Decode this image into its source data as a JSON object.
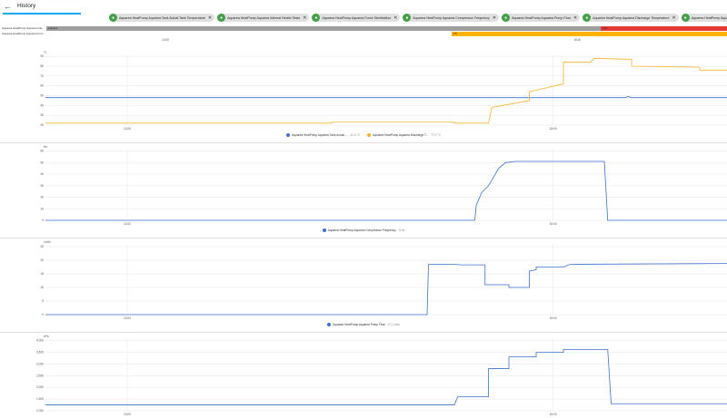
{
  "header": {
    "title": "History",
    "back_icon": "arrow-left-icon"
  },
  "chips": [
    {
      "label": "Aquarea HeatPump Aquarea Tank Actual Tank Temperature",
      "icon": "thermometer-icon"
    },
    {
      "label": "Aquarea HeatPump Aquarea Internal Heater State",
      "icon": "thermometer-icon"
    },
    {
      "label": "Aquarea HeatPump Aquarea Force Sterilization",
      "icon": "water-icon"
    },
    {
      "label": "Aquarea HeatPump Aquarea Compressor Frequency",
      "icon": "pulse-icon"
    },
    {
      "label": "Aquarea HeatPump Aquarea Pump Flow",
      "icon": "pump-icon"
    },
    {
      "label": "Aquarea HeatPump Aquarea Discharge Temperature",
      "icon": "thermometer-icon"
    },
    {
      "label": "Aquarea HeatPump Aquarea High pressure",
      "icon": "gauge-icon"
    }
  ],
  "timeline": {
    "rows": [
      {
        "label": "Aquarea HeatPump Aquarea Inte...",
        "segments": [
          {
            "label": "Inactive",
            "from": 0,
            "to": 0.815,
            "color": "#9e9e9e"
          },
          {
            "label": "Hot",
            "from": 0.815,
            "to": 1,
            "color": "#e53935"
          }
        ]
      },
      {
        "label": "Aquarea HeatPump Aquarea Forc...",
        "segments": [
          {
            "label": "Off",
            "from": 0.595,
            "to": 1,
            "color": "#ffb300"
          }
        ]
      }
    ],
    "ticks": [
      {
        "label": "13:00",
        "pos": 0.175
      },
      {
        "label": "15:00",
        "pos": 0.78
      }
    ]
  },
  "charts": [
    {
      "unit": "°C",
      "y_ticks": [
        20,
        30,
        40,
        50,
        60,
        70,
        80,
        90
      ],
      "ylim": [
        20,
        92
      ],
      "x_ticks": [
        {
          "label": "13:00",
          "pos": 0.12
        },
        {
          "label": "15:00",
          "pos": 0.745
        }
      ],
      "series": [
        {
          "name": "Aquarea HeatPump Aquarea Tank Actual ...",
          "value_label": "61.0 °C",
          "color": "#3f6fd1",
          "points": [
            [
              0,
              48
            ],
            [
              0.85,
              48
            ],
            [
              0.855,
              49
            ],
            [
              0.86,
              48
            ],
            [
              1,
              48
            ]
          ]
        },
        {
          "name": "Aquarea HeatPump Aquarea Discharge T...",
          "value_label": "77.0 °C",
          "color": "#f4b42a",
          "points": [
            [
              0,
              22
            ],
            [
              0.42,
              22
            ],
            [
              0.42,
              23
            ],
            [
              0.6,
              23
            ],
            [
              0.6,
              22
            ],
            [
              0.65,
              22
            ],
            [
              0.655,
              38
            ],
            [
              0.71,
              45
            ],
            [
              0.71,
              54
            ],
            [
              0.76,
              62
            ],
            [
              0.76,
              84
            ],
            [
              0.8,
              84
            ],
            [
              0.805,
              88
            ],
            [
              0.86,
              87
            ],
            [
              0.86,
              80
            ],
            [
              0.96,
              79
            ],
            [
              0.96,
              76
            ],
            [
              1,
              76
            ]
          ]
        }
      ]
    },
    {
      "unit": "Hz",
      "y_ticks": [
        0,
        10,
        20,
        30,
        40,
        50,
        60
      ],
      "ylim": [
        0,
        62
      ],
      "x_ticks": [
        {
          "label": "13:00",
          "pos": 0.12
        },
        {
          "label": "15:00",
          "pos": 0.745
        }
      ],
      "series": [
        {
          "name": "Aquarea HeatPump Aquarea Compressor Frequency",
          "value_label": "0 Hz",
          "color": "#3f6fd1",
          "points": [
            [
              0,
              0
            ],
            [
              0.63,
              0
            ],
            [
              0.632,
              13
            ],
            [
              0.64,
              24
            ],
            [
              0.65,
              30
            ],
            [
              0.66,
              40
            ],
            [
              0.665,
              45
            ],
            [
              0.675,
              50
            ],
            [
              0.69,
              51
            ],
            [
              0.82,
              51
            ],
            [
              0.825,
              0
            ],
            [
              1,
              0
            ]
          ]
        }
      ]
    },
    {
      "unit": "L/min",
      "y_ticks": [
        0,
        5,
        10,
        15,
        20,
        25
      ],
      "ylim": [
        0,
        26
      ],
      "x_ticks": [
        {
          "label": "13:00",
          "pos": 0.12
        },
        {
          "label": "15:00",
          "pos": 0.745
        }
      ],
      "series": [
        {
          "name": "Aquarea HeatPump Aquarea Pump Flow",
          "value_label": "0.7 L/min",
          "color": "#3f6fd1",
          "points": [
            [
              0,
              0
            ],
            [
              0.56,
              0
            ],
            [
              0.562,
              18.5
            ],
            [
              0.6,
              18.5
            ],
            [
              0.61,
              18.3
            ],
            [
              0.645,
              18.3
            ],
            [
              0.645,
              11
            ],
            [
              0.68,
              11
            ],
            [
              0.68,
              10
            ],
            [
              0.71,
              10
            ],
            [
              0.71,
              16
            ],
            [
              0.72,
              16.5
            ],
            [
              0.72,
              17.5
            ],
            [
              0.76,
              17.5
            ],
            [
              0.77,
              18.5
            ],
            [
              1,
              18.8
            ]
          ]
        }
      ]
    },
    {
      "unit": "kPa",
      "y_ticks": [
        1000,
        1500,
        2000,
        2500,
        3000,
        3500,
        4000
      ],
      "ylim": [
        1000,
        4100
      ],
      "x_ticks": [
        {
          "label": "13:00",
          "pos": 0.12
        },
        {
          "label": "15:00",
          "pos": 0.745
        }
      ],
      "series": [
        {
          "name": "Aquarea HeatPump Aquarea High pressure",
          "value_label": "",
          "color": "#3f6fd1",
          "points": [
            [
              0,
              1250
            ],
            [
              0.6,
              1250
            ],
            [
              0.605,
              1600
            ],
            [
              0.65,
              1600
            ],
            [
              0.65,
              2800
            ],
            [
              0.68,
              2800
            ],
            [
              0.68,
              3300
            ],
            [
              0.72,
              3300
            ],
            [
              0.72,
              3500
            ],
            [
              0.76,
              3500
            ],
            [
              0.76,
              3620
            ],
            [
              0.825,
              3620
            ],
            [
              0.83,
              1300
            ],
            [
              1,
              1300
            ]
          ]
        }
      ]
    }
  ]
}
